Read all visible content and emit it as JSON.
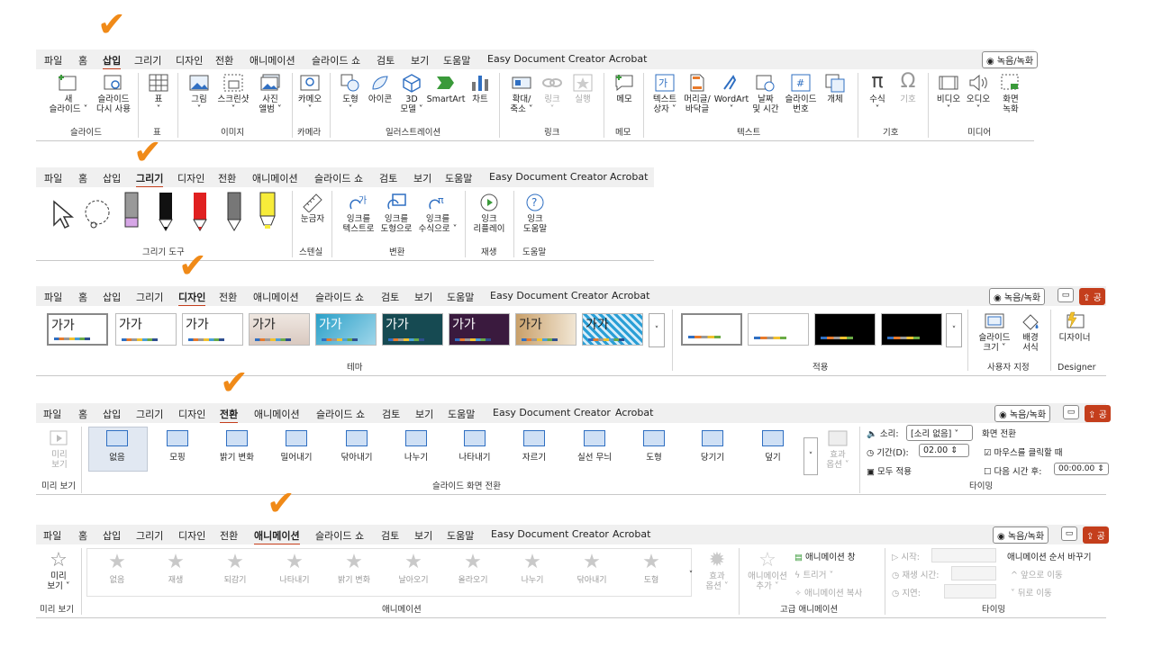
{
  "tabs": [
    "파일",
    "홈",
    "삽입",
    "그리기",
    "디자인",
    "전환",
    "애니메이션",
    "슬라이드 쇼",
    "검토",
    "보기",
    "도움말",
    "Easy Document Creator",
    "Acrobat"
  ],
  "record_label": "◉ 녹음/녹화",
  "comment_icon": "comment-icon",
  "share_label": "공",
  "check_icon": "✔",
  "insert": {
    "buttons": [
      {
        "id": "new-slide",
        "label": "새\n슬라이드 ˅"
      },
      {
        "id": "reuse",
        "label": "슬라이드\n다시 사용"
      },
      {
        "id": "table",
        "label": "표\n˅"
      },
      {
        "id": "picture",
        "label": "그림\n˅"
      },
      {
        "id": "screenshot",
        "label": "스크린샷\n˅"
      },
      {
        "id": "album",
        "label": "사진\n앨범 ˅"
      },
      {
        "id": "camera",
        "label": "카메오\n˅"
      },
      {
        "id": "shapes",
        "label": "도형\n˅"
      },
      {
        "id": "icons",
        "label": "아이콘"
      },
      {
        "id": "3d",
        "label": "3D\n모델 ˅"
      },
      {
        "id": "smartart",
        "label": "SmartArt"
      },
      {
        "id": "chart",
        "label": "차트"
      },
      {
        "id": "zoom",
        "label": "확대/\n축소 ˅"
      },
      {
        "id": "link",
        "label": "링크\n˅"
      },
      {
        "id": "action",
        "label": "실행"
      },
      {
        "id": "comment",
        "label": "메모"
      },
      {
        "id": "textbox",
        "label": "텍스트\n상자 ˅"
      },
      {
        "id": "header",
        "label": "머리글/\n바닥글"
      },
      {
        "id": "wordart",
        "label": "WordArt\n˅"
      },
      {
        "id": "date",
        "label": "날짜\n및 시간"
      },
      {
        "id": "slidenum",
        "label": "슬라이드\n번호"
      },
      {
        "id": "object",
        "label": "개체"
      },
      {
        "id": "equation",
        "label": "수식\n˅"
      },
      {
        "id": "symbol",
        "label": "기호"
      },
      {
        "id": "video",
        "label": "비디오\n˅"
      },
      {
        "id": "audio",
        "label": "오디오\n˅"
      },
      {
        "id": "screenrec",
        "label": "화면\n녹화"
      }
    ],
    "groups": [
      "슬라이드",
      "표",
      "이미지",
      "카메라",
      "일러스트레이션",
      "링크",
      "메모",
      "텍스트",
      "기호",
      "미디어"
    ]
  },
  "draw": {
    "buttons": [
      {
        "id": "ruler",
        "label": "눈금자"
      },
      {
        "id": "ink-text",
        "label": "잉크를\n텍스트로"
      },
      {
        "id": "ink-shape",
        "label": "잉크를\n도형으로"
      },
      {
        "id": "ink-math",
        "label": "잉크를\n수식으로 ˅"
      },
      {
        "id": "replay",
        "label": "잉크\n리플레이"
      },
      {
        "id": "help",
        "label": "잉크\n도움말"
      }
    ],
    "groups": [
      "그리기 도구",
      "스텐실",
      "변환",
      "재생",
      "도움말"
    ]
  },
  "design": {
    "theme_label": "가가",
    "buttons": [
      {
        "id": "slide-size",
        "label": "슬라이드\n크기 ˅"
      },
      {
        "id": "format-bg",
        "label": "배경\n서식"
      },
      {
        "id": "designer",
        "label": "디자이너"
      }
    ],
    "groups": [
      "테마",
      "적용",
      "사용자 지정",
      "Designer"
    ]
  },
  "transition": {
    "preview": "미리\n보기",
    "items": [
      "없음",
      "모핑",
      "밝기 변화",
      "밀어내기",
      "닦아내기",
      "나누기",
      "나타내기",
      "자르기",
      "실선 무늬",
      "도형",
      "당기기",
      "덮기"
    ],
    "effect": "효과\n옵션 ˅",
    "sound_label": "🔈 소리:",
    "sound_value": "[소리 없음]",
    "duration_label": "기간(D):",
    "duration_value": "02.00",
    "apply_all": "모두 적용",
    "advance_title": "화면 전환",
    "on_click": "마우스를 클릭할 때",
    "after": "다음 시간 후:",
    "after_value": "00:00.00",
    "groups": [
      "미리 보기",
      "슬라이드 화면 전환",
      "타이밍"
    ]
  },
  "animation": {
    "preview": "미리\n보기 ˅",
    "items": [
      "없음",
      "재생",
      "되감기",
      "나타내기",
      "밝기 변화",
      "날아오기",
      "올라오기",
      "나누기",
      "닦아내기",
      "도형"
    ],
    "effect": "효과\n옵션 ˅",
    "add": "애니메이션\n추가 ˅",
    "pane": "애니메이션 창",
    "trigger": "트리거 ˅",
    "painter": "애니메이션 복사",
    "start": "시작:",
    "duration": "재생 시간:",
    "delay": "지연:",
    "reorder": "애니메이션 순서 바꾸기",
    "forward": "^ 앞으로 이동",
    "backward": "˅ 뒤로 이동",
    "groups": [
      "미리 보기",
      "애니메이션",
      "고급 애니메이션",
      "타이밍"
    ]
  }
}
